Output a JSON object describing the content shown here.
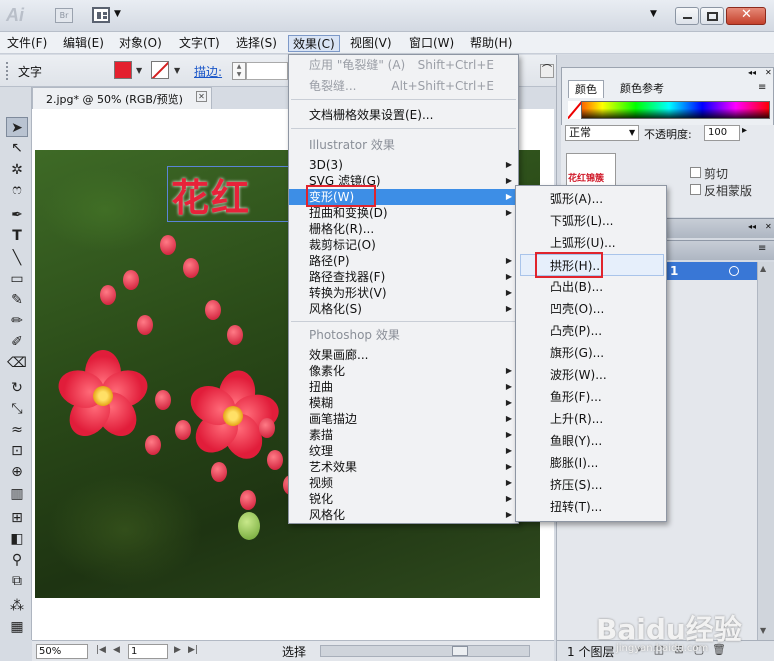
{
  "title_bar": {
    "app_logo": "Ai",
    "bridge_icon": "Br"
  },
  "menu_bar": {
    "items": [
      "文件(F)",
      "编辑(E)",
      "对象(O)",
      "文字(T)",
      "选择(S)",
      "效果(C)",
      "视图(V)",
      "窗口(W)",
      "帮助(H)"
    ]
  },
  "control_bar": {
    "object_label": "文字",
    "stroke_label": "描边:",
    "fill_color": "#e4202e"
  },
  "document": {
    "tab_label": "2.jpg* @ 50% (RGB/预览)",
    "art_text": "花红"
  },
  "status_bar": {
    "zoom": "50%",
    "page": "1",
    "status": "选择"
  },
  "effect_menu": {
    "apply_last": {
      "label": "应用 \"龟裂缝\" (A)",
      "shortcut": "Shift+Ctrl+E"
    },
    "last_effect": {
      "label": "龟裂缝...",
      "shortcut": "Alt+Shift+Ctrl+E"
    },
    "doc_raster": "文档栅格效果设置(E)...",
    "illustrator_header": "Illustrator 效果",
    "illustrator_items": [
      "3D(3)",
      "SVG 滤镜(G)",
      "变形(W)",
      "扭曲和变换(D)",
      "栅格化(R)...",
      "裁剪标记(O)",
      "路径(P)",
      "路径查找器(F)",
      "转换为形状(V)",
      "风格化(S)"
    ],
    "photoshop_header": "Photoshop 效果",
    "photoshop_items": [
      "效果画廊...",
      "像素化",
      "扭曲",
      "模糊",
      "画笔描边",
      "素描",
      "纹理",
      "艺术效果",
      "视频",
      "锐化",
      "风格化"
    ]
  },
  "warp_submenu": {
    "items": [
      "弧形(A)...",
      "下弧形(L)...",
      "上弧形(U)...",
      "拱形(H)...",
      "凸出(B)...",
      "凹壳(O)...",
      "凸壳(P)...",
      "旗形(G)...",
      "波形(W)...",
      "鱼形(F)...",
      "上升(R)...",
      "鱼眼(Y)...",
      "膨胀(I)...",
      "挤压(S)...",
      "扭转(T)..."
    ]
  },
  "color_panel": {
    "tab_color": "颜色",
    "tab_color_guide": "颜色参考"
  },
  "transparency_panel": {
    "blend_mode": "正常",
    "opacity_label": "不透明度:",
    "opacity_value": "100",
    "thumbnail_text": "花红锦簇",
    "clip_label": "剪切",
    "invert_label": "反相蒙版"
  },
  "layers_panel": {
    "layer_number": "1",
    "layer_count": "1 个图层"
  },
  "watermark": {
    "line1": "Baidu经验",
    "line2": "jingyan.baidu.com"
  }
}
